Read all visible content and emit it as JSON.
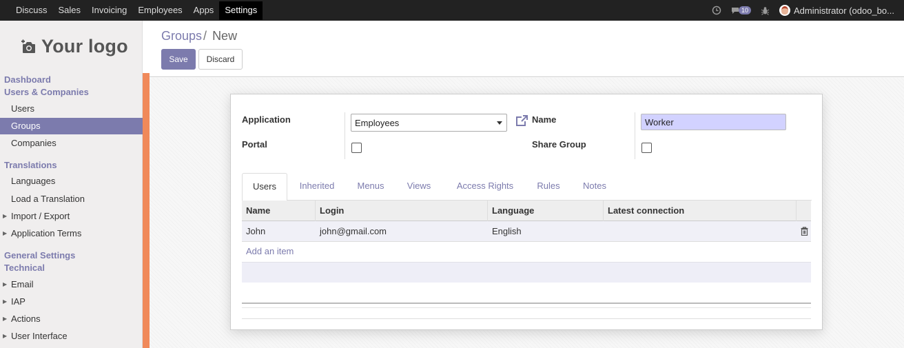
{
  "topbar": {
    "menu": [
      "Discuss",
      "Sales",
      "Invoicing",
      "Employees",
      "Apps",
      "Settings"
    ],
    "active": "Settings",
    "chat_count": "10",
    "user": "Administrator (odoo_bo..."
  },
  "sidebar": {
    "logo_text": "Your logo",
    "sections": {
      "dashboard": "Dashboard",
      "users_companies": "Users & Companies",
      "translations": "Translations",
      "general_settings": "General Settings",
      "technical": "Technical"
    },
    "items": {
      "users": "Users",
      "groups": "Groups",
      "companies": "Companies",
      "languages": "Languages",
      "load_translation": "Load a Translation",
      "import_export": "Import / Export",
      "application_terms": "Application Terms",
      "email": "Email",
      "iap": "IAP",
      "actions": "Actions",
      "user_interface": "User Interface"
    },
    "active_item": "Groups"
  },
  "control": {
    "breadcrumb_parent": "Groups",
    "breadcrumb_sep": "/",
    "breadcrumb_current": "New",
    "save_label": "Save",
    "discard_label": "Discard"
  },
  "form": {
    "application_label": "Application",
    "application_value": "Employees",
    "name_label": "Name",
    "name_value": "Worker",
    "portal_label": "Portal",
    "portal_checked": false,
    "share_group_label": "Share Group",
    "share_group_checked": false
  },
  "tabs": [
    "Users",
    "Inherited",
    "Menus",
    "Views",
    "Access Rights",
    "Rules",
    "Notes"
  ],
  "active_tab": "Users",
  "table": {
    "columns": [
      "Name",
      "Login",
      "Language",
      "Latest connection"
    ],
    "rows": [
      {
        "name": "John",
        "login": "john@gmail.com",
        "language": "English",
        "latest_connection": ""
      }
    ],
    "add_item": "Add an item"
  },
  "colors": {
    "brand": "#7c7bad",
    "accent_bar": "#f0895a",
    "name_field_bg": "#d2d2ff"
  }
}
